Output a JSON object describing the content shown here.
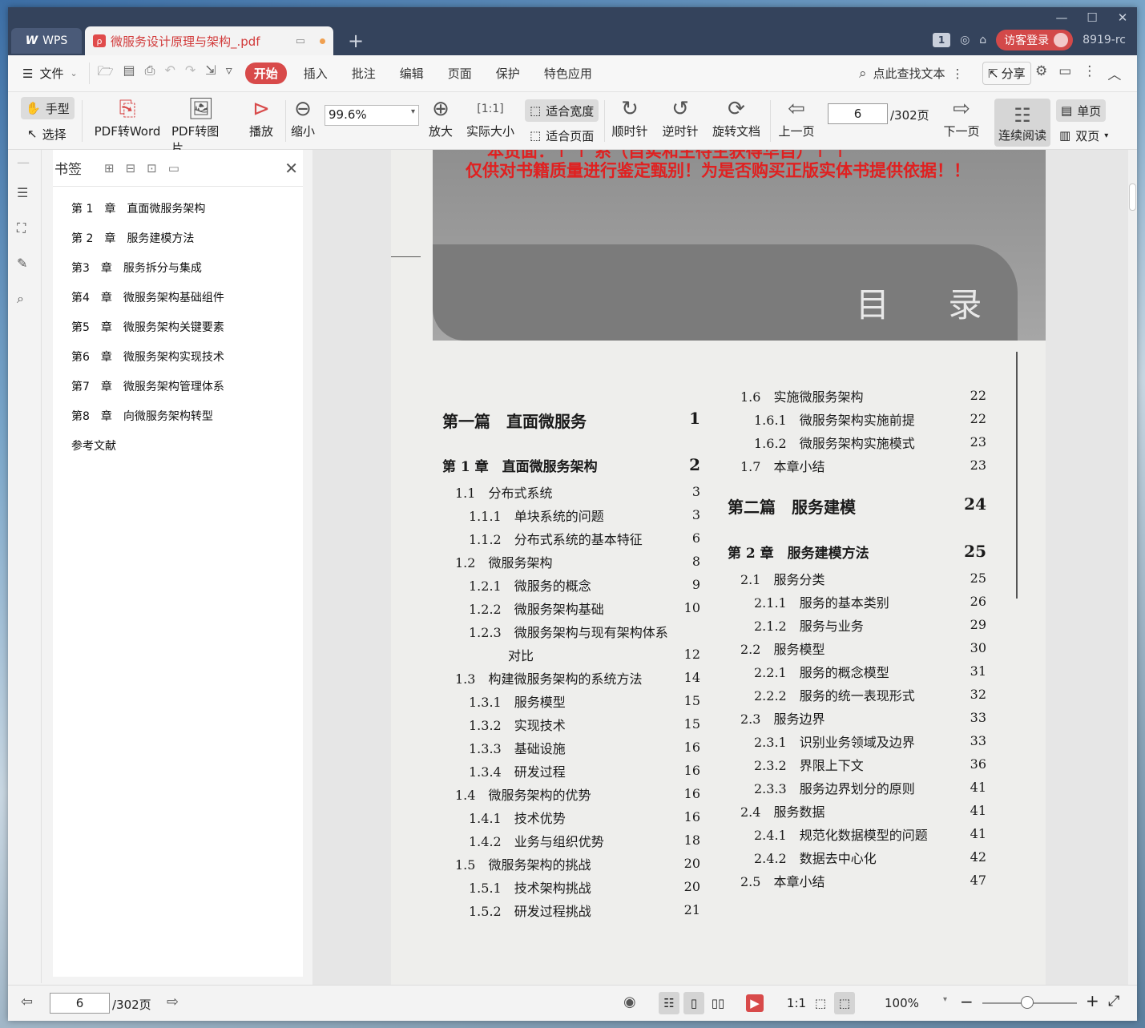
{
  "app": {
    "name": "WPS"
  },
  "tab": {
    "title": "微服务设计原理与架构_.pdf"
  },
  "window": {
    "badge": "1",
    "guest_label": "访客登录",
    "user_id": "8919-rc"
  },
  "menu": {
    "file": "文件",
    "items": [
      "开始",
      "插入",
      "批注",
      "编辑",
      "页面",
      "保护",
      "特色应用"
    ],
    "search_placeholder": "点此查找文本",
    "share": "分享"
  },
  "toolbar": {
    "hand": "手型",
    "select": "选择",
    "pdf_to_word": "PDF转Word",
    "pdf_to_image": "PDF转图片",
    "play": "播放",
    "zoom_out": "缩小",
    "zoom_value": "99.6%",
    "zoom_in": "放大",
    "actual_size": "实际大小",
    "fit_width": "适合宽度",
    "fit_page": "适合页面",
    "clockwise": "顺时针",
    "counterclockwise": "逆时针",
    "rotate_doc": "旋转文档",
    "prev_page": "上一页",
    "page_value": "6",
    "page_total": "/302页",
    "next_page": "下一页",
    "continuous": "连续阅读",
    "single": "单页",
    "double": "双页"
  },
  "bookmarks": {
    "title": "书签",
    "items": [
      "第 1　章　直面微服务架构",
      "第 2　章　服务建模方法",
      "第3　章　服务拆分与集成",
      "第4　章　微服务架构基础组件",
      "第5　章　微服务架构关键要素",
      "第6　章　微服务架构实现技术",
      "第7　章　微服务架构管理体系",
      "第8　章　向微服务架构转型",
      "参考文献"
    ]
  },
  "pdf": {
    "watermark_top": "本贡面：↑ ↑ 系（自实和主待主获得华自）↑ ↑",
    "watermark": "仅供对书籍质量进行鉴定甄别！为是否购买正版实体书提供依据！！",
    "heading": "目 录",
    "left_col": [
      {
        "text": "第一篇　直面微服务",
        "page": "1",
        "kind": "part"
      },
      {
        "text": "第 1 章　直面微服务架构",
        "page": "2",
        "kind": "chap"
      },
      {
        "text": "1.1　分布式系统",
        "page": "3",
        "kind": "l1"
      },
      {
        "text": "1.1.1　单块系统的问题",
        "page": "3",
        "kind": "l2"
      },
      {
        "text": "1.1.2　分布式系统的基本特征",
        "page": "6",
        "kind": "l2"
      },
      {
        "text": "1.2　微服务架构",
        "page": "8",
        "kind": "l1"
      },
      {
        "text": "1.2.1　微服务的概念",
        "page": "9",
        "kind": "l2"
      },
      {
        "text": "1.2.2　微服务架构基础",
        "page": "10",
        "kind": "l2"
      },
      {
        "text": "1.2.3　微服务架构与现有架构体系",
        "page": "",
        "kind": "l2"
      },
      {
        "text": "对比",
        "page": "12",
        "kind": "l3"
      },
      {
        "text": "1.3　构建微服务架构的系统方法",
        "page": "14",
        "kind": "l1"
      },
      {
        "text": "1.3.1　服务模型",
        "page": "15",
        "kind": "l2"
      },
      {
        "text": "1.3.2　实现技术",
        "page": "15",
        "kind": "l2"
      },
      {
        "text": "1.3.3　基础设施",
        "page": "16",
        "kind": "l2"
      },
      {
        "text": "1.3.4　研发过程",
        "page": "16",
        "kind": "l2"
      },
      {
        "text": "1.4　微服务架构的优势",
        "page": "16",
        "kind": "l1"
      },
      {
        "text": "1.4.1　技术优势",
        "page": "16",
        "kind": "l2"
      },
      {
        "text": "1.4.2　业务与组织优势",
        "page": "18",
        "kind": "l2"
      },
      {
        "text": "1.5　微服务架构的挑战",
        "page": "20",
        "kind": "l1"
      },
      {
        "text": "1.5.1　技术架构挑战",
        "page": "20",
        "kind": "l2"
      },
      {
        "text": "1.5.2　研发过程挑战",
        "page": "21",
        "kind": "l2"
      }
    ],
    "right_col": [
      {
        "text": "1.6　实施微服务架构",
        "page": "22",
        "kind": "l1"
      },
      {
        "text": "1.6.1　微服务架构实施前提",
        "page": "22",
        "kind": "l2"
      },
      {
        "text": "1.6.2　微服务架构实施模式",
        "page": "23",
        "kind": "l2"
      },
      {
        "text": "1.7　本章小结",
        "page": "23",
        "kind": "l1"
      },
      {
        "text": "第二篇　服务建模",
        "page": "24",
        "kind": "part"
      },
      {
        "text": "第 2 章　服务建模方法",
        "page": "25",
        "kind": "chap"
      },
      {
        "text": "2.1　服务分类",
        "page": "25",
        "kind": "l1"
      },
      {
        "text": "2.1.1　服务的基本类别",
        "page": "26",
        "kind": "l2"
      },
      {
        "text": "2.1.2　服务与业务",
        "page": "29",
        "kind": "l2"
      },
      {
        "text": "2.2　服务模型",
        "page": "30",
        "kind": "l1"
      },
      {
        "text": "2.2.1　服务的概念模型",
        "page": "31",
        "kind": "l2"
      },
      {
        "text": "2.2.2　服务的统一表现形式",
        "page": "32",
        "kind": "l2"
      },
      {
        "text": "2.3　服务边界",
        "page": "33",
        "kind": "l1"
      },
      {
        "text": "2.3.1　识别业务领域及边界",
        "page": "33",
        "kind": "l2"
      },
      {
        "text": "2.3.2　界限上下文",
        "page": "36",
        "kind": "l2"
      },
      {
        "text": "2.3.3　服务边界划分的原则",
        "page": "41",
        "kind": "l2"
      },
      {
        "text": "2.4　服务数据",
        "page": "41",
        "kind": "l1"
      },
      {
        "text": "2.4.1　规范化数据模型的问题",
        "page": "41",
        "kind": "l2"
      },
      {
        "text": "2.4.2　数据去中心化",
        "page": "42",
        "kind": "l2"
      },
      {
        "text": "2.5　本章小结",
        "page": "47",
        "kind": "l1"
      }
    ]
  },
  "status": {
    "page_value": "6",
    "page_total": "/302页",
    "zoom": "100%"
  },
  "colors": {
    "accent": "#d84a4a",
    "titlebar": "#34435c",
    "watermark": "#e02020"
  }
}
